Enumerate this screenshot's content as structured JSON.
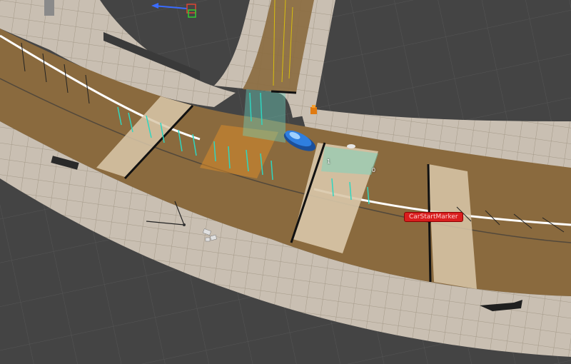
{
  "scene": {
    "marker_label": "CarStartMarker",
    "segment_labels": [
      "1",
      "0"
    ]
  },
  "colors": {
    "background": "#444444",
    "grid": "#555555",
    "sidewalk": "#c9bfb2",
    "curb": "#a89c8c",
    "road": "#8a6a3e",
    "overlay_orange": "#d98a2a",
    "overlay_teal": "#6fd8c4",
    "car": "#2f7fe0",
    "marker": "#d91e1e"
  },
  "icons": {
    "gizmo": "transform-gizmo-icon",
    "car": "car-icon",
    "cone": "traffic-cone-icon"
  }
}
